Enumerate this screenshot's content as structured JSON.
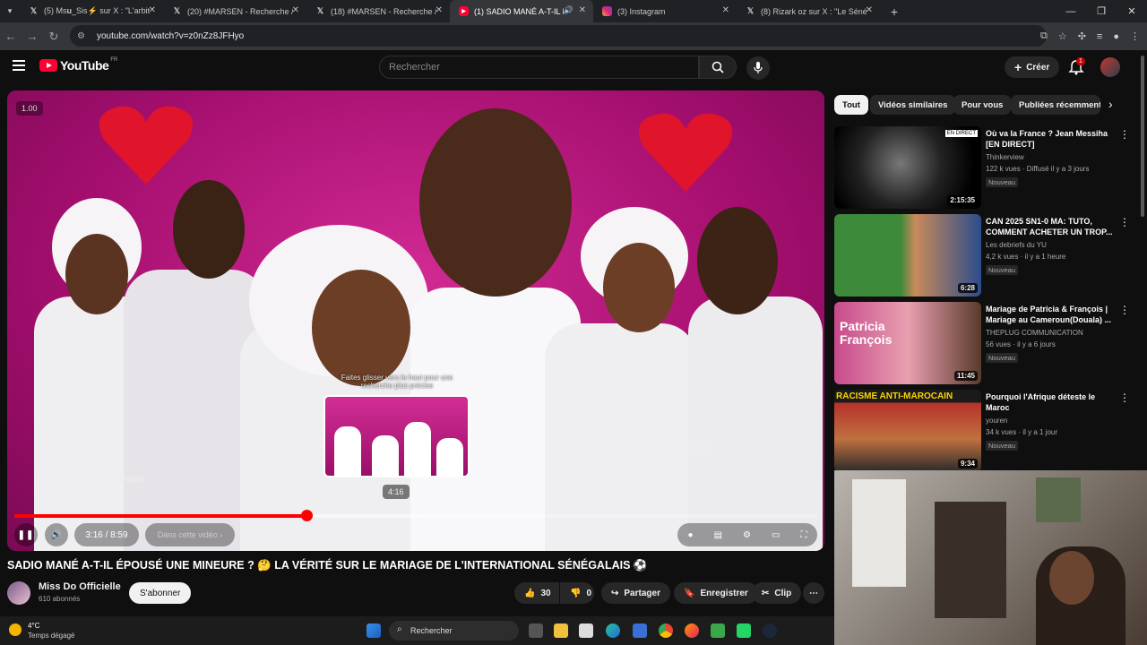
{
  "tabs": [
    {
      "label": "(5) Ms𝐮_Sis⚡ sur X : \"L'arbitre",
      "icon": "x-icon"
    },
    {
      "label": "(20) #MARSEN - Recherche / X",
      "icon": "x-icon"
    },
    {
      "label": "(18) #MARSEN - Recherche / X",
      "icon": "x-icon"
    },
    {
      "label": "(1) SADIO MANÉ A-T-IL ÉPO",
      "icon": "youtube-icon",
      "active": true
    },
    {
      "label": "(3) Instagram",
      "icon": "instagram-icon"
    },
    {
      "label": "(8) Rizark oz sur X : \"Le Sénégal",
      "icon": "x-icon"
    }
  ],
  "address": {
    "url": "youtube.com/watch?v=z0nZz8JFHyo"
  },
  "youtube": {
    "brand": "YouTube",
    "region": "FR",
    "search_placeholder": "Rechercher",
    "create_label": "Créer",
    "notifications": "1"
  },
  "player": {
    "speed": "1.00",
    "hint": "Faites glisser vers le haut pour une recherche plus précise",
    "hover_time": "4:16",
    "time": "3:16 / 8:59",
    "chapter": "Dans cette vidéo",
    "watermark": "MAGVISION",
    "progress": 0.364,
    "buffered": 0.508
  },
  "video": {
    "title": "SADIO MANÉ A-T-IL ÉPOUSÉ UNE MINEURE ? 🤔 LA VÉRITÉ SUR LE MARIAGE DE L'INTERNATIONAL SÉNÉGALAIS ⚽",
    "channel": "Miss Do Officielle",
    "subscribers": "610 abonnés",
    "subscribe": "S'abonner",
    "likes": "30",
    "dislikes": "0",
    "share": "Partager",
    "save": "Enregistrer",
    "clip": "Clip"
  },
  "chips": [
    "Tout",
    "Vidéos similaires",
    "Pour vous",
    "Publiées récemment"
  ],
  "recommendations": [
    {
      "title": "Où va la France ? Jean Messiha [EN DIRECT]",
      "channel": "Thinkerview",
      "meta": "122 k vues · Diffusé il y a 3 jours",
      "badge": "Nouveau",
      "duration": "2:15:35",
      "thumb_label": "EN DIRECT"
    },
    {
      "title": "CAN 2025 SN1-0 MA: TUTO, COMMENT ACHETER UN TROP...",
      "channel": "Les debriefs du YU",
      "meta": "4,2 k vues · il y a 1 heure",
      "badge": "Nouveau",
      "duration": "6:28"
    },
    {
      "title": "Mariage de Patricia & François | Mariage au Cameroun(Douala) ...",
      "channel": "THEPLUG COMMUNICATION",
      "meta": "56 vues · il y a 6 jours",
      "badge": "Nouveau",
      "duration": "11:45",
      "thumb_label": "Patricia François"
    },
    {
      "title": "Pourquoi l'Afrique déteste le Maroc",
      "channel": "youren",
      "meta": "34 k vues · il y a 1 jour",
      "badge": "Nouveau",
      "duration": "9:34",
      "thumb_label": "RACISME ANTI-MAROCAIN"
    }
  ],
  "taskbar": {
    "weather_temp": "4°C",
    "weather_desc": "Temps dégagé",
    "search": "Rechercher"
  }
}
